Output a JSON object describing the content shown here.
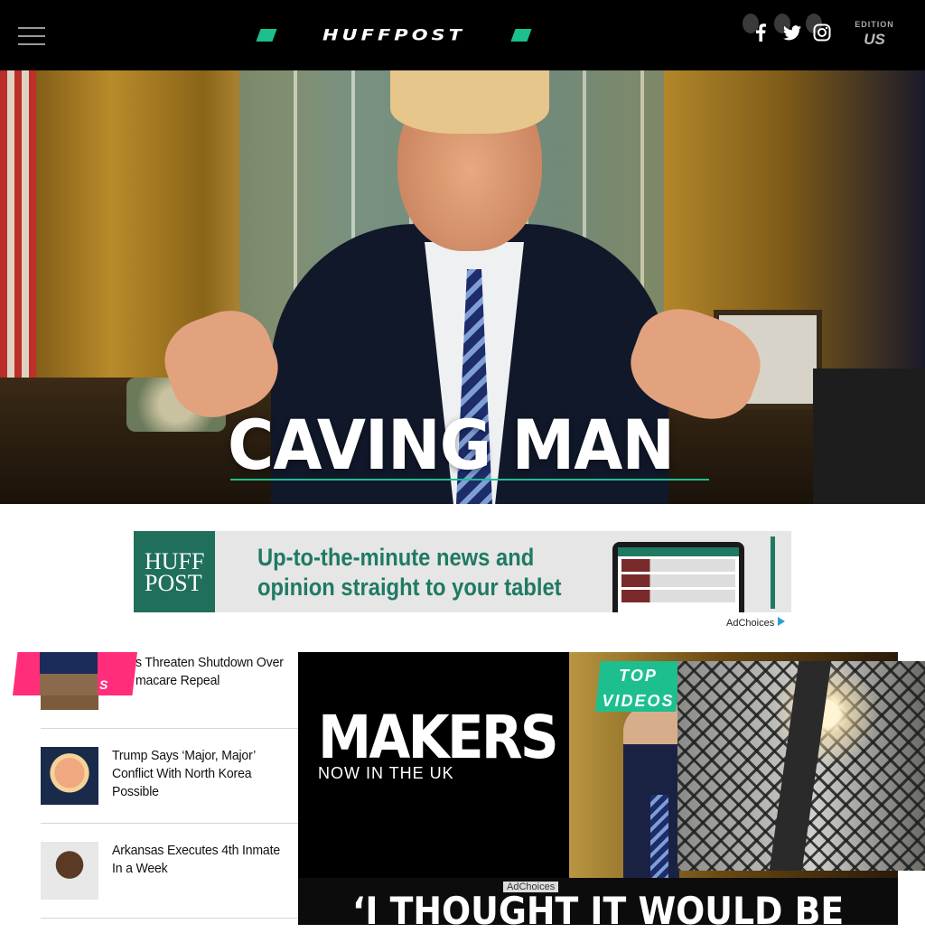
{
  "header": {
    "logo_text": "HUFFPOST",
    "edition_label": "EDITION",
    "edition_value": "US",
    "social": [
      "facebook-icon",
      "twitter-icon",
      "instagram-icon"
    ],
    "colors": {
      "background": "#000000",
      "accent": "#1dbf8e"
    }
  },
  "hero": {
    "headline": "CAVING MAN"
  },
  "ad": {
    "badge_line1": "HUFF",
    "badge_line2": "POST",
    "line1": "Up-to-the-minute news and",
    "line2": "opinion straight to your tablet",
    "adchoices": "AdChoices"
  },
  "stories": [
    {
      "title": "s Threaten Shutdown Over macare Repeal"
    },
    {
      "title": "Trump Says ‘Major, Major’ Conflict With North Korea Possible"
    },
    {
      "title": "Arkansas Executes 4th Inmate In a Week"
    }
  ],
  "tag": {
    "letter": "S",
    "color": "#ff2d7a"
  },
  "video": {
    "makers_title": "MAKERS",
    "makers_sub": "NOW IN THE UK",
    "top_videos_line1": "TOP",
    "top_videos_line2": "VIDEOS",
    "quote": "‘I THOUGHT IT WOULD BE",
    "adchoices": "AdChoices"
  }
}
